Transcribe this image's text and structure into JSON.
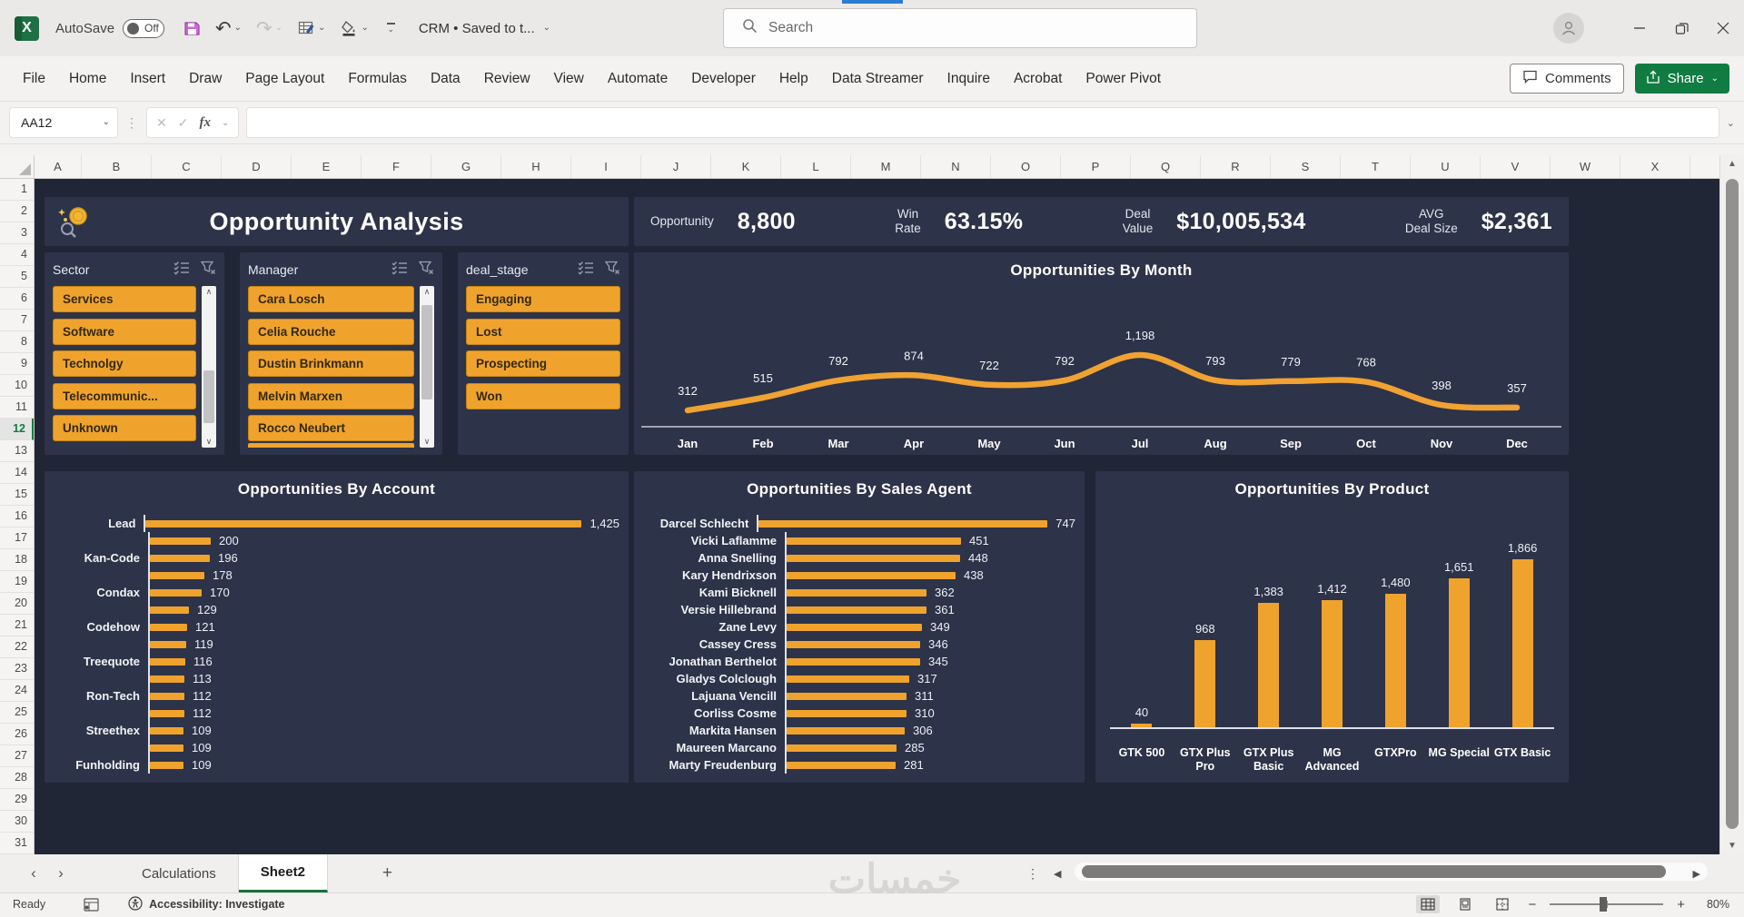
{
  "icons": {
    "chevron_down": "⌄",
    "undo": "↶",
    "redo": "↷",
    "prev": "‹",
    "next": "›",
    "scroll_left": "◀",
    "scroll_right": "▶",
    "dots": "⋮",
    "up_small": "▲",
    "down_small": "▼",
    "arrow_up_small": "∧",
    "arrow_down_small": "∨",
    "cancel": "✕",
    "check": "✓",
    "zoom_out": "−",
    "zoom_in": "+"
  },
  "titlebar": {
    "autosave_label": "AutoSave",
    "autosave_state": "Off",
    "doc_title": "CRM • Saved to t...",
    "search_placeholder": "Search"
  },
  "ribbon": {
    "tabs": [
      "File",
      "Home",
      "Insert",
      "Draw",
      "Page Layout",
      "Formulas",
      "Data",
      "Review",
      "View",
      "Automate",
      "Developer",
      "Help",
      "Data Streamer",
      "Inquire",
      "Acrobat",
      "Power Pivot"
    ],
    "comments_label": "Comments",
    "share_label": "Share"
  },
  "formula_bar": {
    "name_box": "AA12",
    "fx_label": "fx"
  },
  "grid": {
    "column_letters": [
      "A",
      "B",
      "C",
      "D",
      "E",
      "F",
      "G",
      "H",
      "I",
      "J",
      "K",
      "L",
      "M",
      "N",
      "O",
      "P",
      "Q",
      "R",
      "S",
      "T",
      "U",
      "V",
      "W",
      "X"
    ],
    "row_numbers": [
      1,
      2,
      3,
      4,
      5,
      6,
      7,
      8,
      9,
      10,
      11,
      12,
      13,
      14,
      15,
      16,
      17,
      18,
      19,
      20,
      21,
      22,
      23,
      24,
      25,
      26,
      27,
      28,
      29,
      30,
      31
    ],
    "active_row": 12
  },
  "dashboard": {
    "title": "Opportunity Analysis",
    "kpis": [
      {
        "label": "Opportunity",
        "value": "8,800"
      },
      {
        "label": "Win\nRate",
        "value": "63.15%"
      },
      {
        "label": "Deal\nValue",
        "value": "$10,005,534"
      },
      {
        "label": "AVG\nDeal Size",
        "value": "$2,361"
      }
    ],
    "slicers": [
      {
        "title": "Sector",
        "items": [
          "Services",
          "Software",
          "Technolgy",
          "Telecommunic...",
          "Unknown"
        ],
        "scrollbar": {
          "top_pct": 52,
          "height_pct": 33
        },
        "partial_item": false
      },
      {
        "title": "Manager",
        "items": [
          "Cara Losch",
          "Celia Rouche",
          "Dustin Brinkmann",
          "Melvin Marxen",
          "Rocco Neubert"
        ],
        "scrollbar": {
          "top_pct": 12,
          "height_pct": 58
        },
        "partial_item": true
      },
      {
        "title": "deal_stage",
        "items": [
          "Engaging",
          "Lost",
          "Prospecting",
          "Won"
        ],
        "scrollbar": null,
        "partial_item": false
      }
    ],
    "accent_color": "#EFA32D",
    "panel_color": "#2D3348",
    "background_color": "#212636"
  },
  "chart_data": [
    {
      "id": "opportunities_by_month",
      "type": "line",
      "title": "Opportunities By Month",
      "categories": [
        "Jan",
        "Feb",
        "Mar",
        "Apr",
        "May",
        "Jun",
        "Jul",
        "Aug",
        "Sep",
        "Oct",
        "Nov",
        "Dec"
      ],
      "values": [
        312,
        515,
        792,
        874,
        722,
        792,
        1198,
        793,
        779,
        768,
        398,
        357
      ],
      "color": "#F0A232",
      "legend": "none",
      "data_labels": "above",
      "grid": "off"
    },
    {
      "id": "opportunities_by_account",
      "type": "bar",
      "orientation": "horizontal",
      "title": "Opportunities By Account",
      "categories": [
        "Lead",
        "",
        "Kan-Code",
        "",
        "Condax",
        "",
        "Codehow",
        "",
        "Treequote",
        "",
        "Ron-Tech",
        "",
        "Streethex",
        "",
        "Funholding"
      ],
      "values": [
        1425,
        200,
        196,
        178,
        170,
        129,
        121,
        119,
        116,
        113,
        112,
        112,
        109,
        109,
        109
      ],
      "color": "#EFA32D",
      "data_labels": "end",
      "xlim": [
        0,
        1500
      ]
    },
    {
      "id": "opportunities_by_sales_agent",
      "type": "bar",
      "orientation": "horizontal",
      "title": "Opportunities By Sales Agent",
      "categories": [
        "Darcel Schlecht",
        "Vicki Laflamme",
        "Anna Snelling",
        "Kary Hendrixson",
        "Kami Bicknell",
        "Versie Hillebrand",
        "Zane Levy",
        "Cassey Cress",
        "Jonathan Berthelot",
        "Gladys Colclough",
        "Lajuana Vencill",
        "Corliss Cosme",
        "Markita Hansen",
        "Maureen Marcano",
        "Marty Freudenburg"
      ],
      "values": [
        747,
        451,
        448,
        438,
        362,
        361,
        349,
        346,
        345,
        317,
        311,
        310,
        306,
        285,
        281
      ],
      "color": "#EFA32D",
      "data_labels": "end",
      "xlim": [
        0,
        800
      ]
    },
    {
      "id": "opportunities_by_product",
      "type": "bar",
      "orientation": "vertical",
      "title": "Opportunities By Product",
      "categories": [
        "GTK 500",
        "GTX Plus Pro",
        "GTX Plus Basic",
        "MG Advanced",
        "GTXPro",
        "MG Special",
        "GTX Basic"
      ],
      "values": [
        40,
        968,
        1383,
        1412,
        1480,
        1651,
        1866
      ],
      "color": "#EFA32D",
      "data_labels": "above",
      "ylim": [
        0,
        2000
      ]
    }
  ],
  "sheet_tabs": {
    "tabs": [
      {
        "label": "Calculations",
        "active": false
      },
      {
        "label": "Sheet2",
        "active": true
      }
    ],
    "add_label": "+"
  },
  "status_bar": {
    "ready_label": "Ready",
    "accessibility_label": "Accessibility: Investigate",
    "zoom_level": "80%"
  },
  "watermark": {
    "text": "خمسات"
  }
}
